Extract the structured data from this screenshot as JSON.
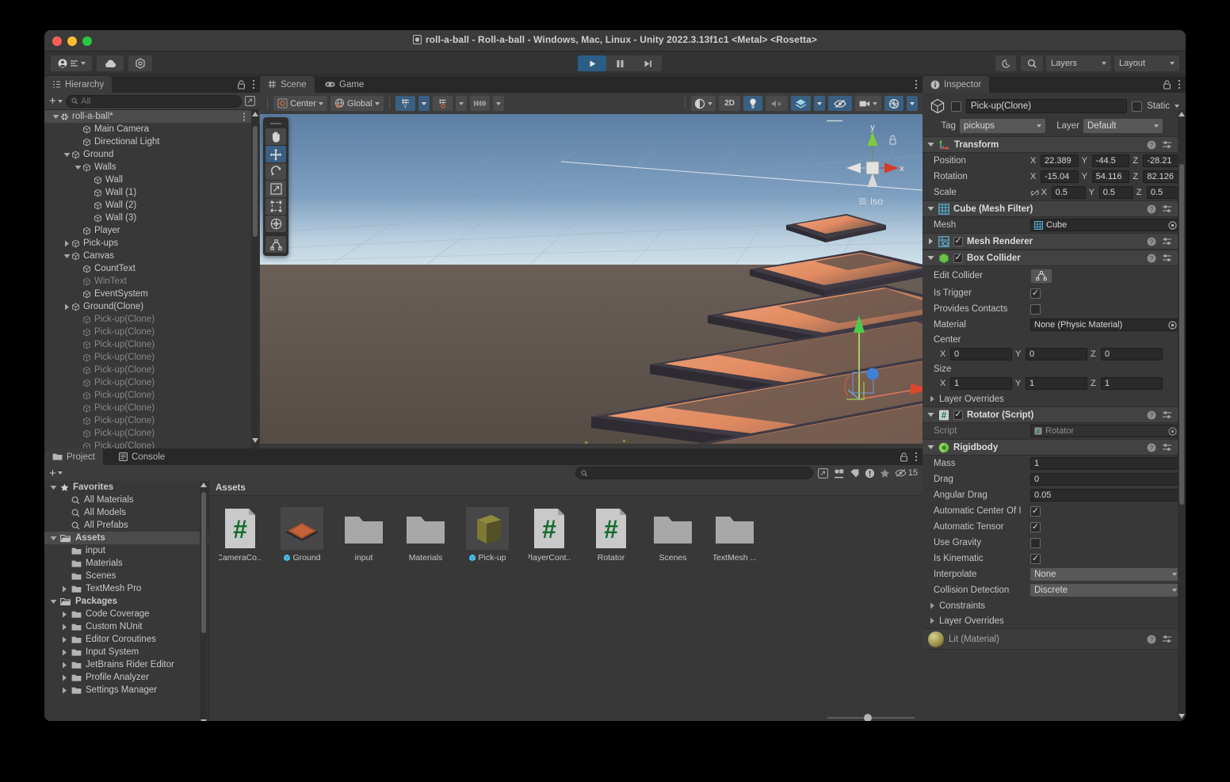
{
  "window": {
    "title": "roll-a-ball - Roll-a-ball - Windows, Mac, Linux - Unity 2022.3.13f1c1 <Metal> <Rosetta>",
    "title_icon": "unity-icon"
  },
  "toolbar": {
    "account_label": "account-icon",
    "cloud_label": "cloud-icon",
    "services_label": "services-icon",
    "play_label": "▶",
    "pause_label": "❚❚",
    "step_label": "▶❙",
    "undo_history_label": "undo-history-icon",
    "search_label": "search-icon",
    "layers_label": "Layers",
    "layout_label": "Layout"
  },
  "hierarchy": {
    "tab_label": "Hierarchy",
    "add_label": "+",
    "search_placeholder": "All",
    "items": [
      {
        "label": "roll-a-ball*",
        "depth": 0,
        "arrow": "down",
        "icon": "unity-scene-icon",
        "selected": true,
        "dim": false
      },
      {
        "label": "Main Camera",
        "depth": 2,
        "arrow": "none",
        "icon": "cube-icon",
        "selected": false,
        "dim": false
      },
      {
        "label": "Directional Light",
        "depth": 2,
        "arrow": "none",
        "icon": "cube-icon",
        "selected": false,
        "dim": false
      },
      {
        "label": "Ground",
        "depth": 1,
        "arrow": "down",
        "icon": "cube-icon",
        "selected": false,
        "dim": false
      },
      {
        "label": "Walls",
        "depth": 2,
        "arrow": "down",
        "icon": "cube-icon",
        "selected": false,
        "dim": false
      },
      {
        "label": "Wall",
        "depth": 3,
        "arrow": "none",
        "icon": "cube-icon",
        "selected": false,
        "dim": false
      },
      {
        "label": "Wall (1)",
        "depth": 3,
        "arrow": "none",
        "icon": "cube-icon",
        "selected": false,
        "dim": false
      },
      {
        "label": "Wall (2)",
        "depth": 3,
        "arrow": "none",
        "icon": "cube-icon",
        "selected": false,
        "dim": false
      },
      {
        "label": "Wall (3)",
        "depth": 3,
        "arrow": "none",
        "icon": "cube-icon",
        "selected": false,
        "dim": false
      },
      {
        "label": "Player",
        "depth": 2,
        "arrow": "none",
        "icon": "cube-icon",
        "selected": false,
        "dim": false
      },
      {
        "label": "Pick-ups",
        "depth": 1,
        "arrow": "right",
        "icon": "cube-icon",
        "selected": false,
        "dim": false
      },
      {
        "label": "Canvas",
        "depth": 1,
        "arrow": "down",
        "icon": "cube-icon",
        "selected": false,
        "dim": false
      },
      {
        "label": "CountText",
        "depth": 2,
        "arrow": "none",
        "icon": "cube-icon",
        "selected": false,
        "dim": false
      },
      {
        "label": "WinText",
        "depth": 2,
        "arrow": "none",
        "icon": "cube-icon",
        "selected": false,
        "dim": true
      },
      {
        "label": "EventSystem",
        "depth": 2,
        "arrow": "none",
        "icon": "cube-icon",
        "selected": false,
        "dim": false
      },
      {
        "label": "Ground(Clone)",
        "depth": 1,
        "arrow": "right",
        "icon": "cube-icon",
        "selected": false,
        "dim": false
      },
      {
        "label": "Pick-up(Clone)",
        "depth": 2,
        "arrow": "none",
        "icon": "cube-icon",
        "selected": false,
        "dim": true
      },
      {
        "label": "Pick-up(Clone)",
        "depth": 2,
        "arrow": "none",
        "icon": "cube-icon",
        "selected": false,
        "dim": true
      },
      {
        "label": "Pick-up(Clone)",
        "depth": 2,
        "arrow": "none",
        "icon": "cube-icon",
        "selected": false,
        "dim": true
      },
      {
        "label": "Pick-up(Clone)",
        "depth": 2,
        "arrow": "none",
        "icon": "cube-icon",
        "selected": false,
        "dim": true
      },
      {
        "label": "Pick-up(Clone)",
        "depth": 2,
        "arrow": "none",
        "icon": "cube-icon",
        "selected": false,
        "dim": true
      },
      {
        "label": "Pick-up(Clone)",
        "depth": 2,
        "arrow": "none",
        "icon": "cube-icon",
        "selected": false,
        "dim": true
      },
      {
        "label": "Pick-up(Clone)",
        "depth": 2,
        "arrow": "none",
        "icon": "cube-icon",
        "selected": false,
        "dim": true
      },
      {
        "label": "Pick-up(Clone)",
        "depth": 2,
        "arrow": "none",
        "icon": "cube-icon",
        "selected": false,
        "dim": true
      },
      {
        "label": "Pick-up(Clone)",
        "depth": 2,
        "arrow": "none",
        "icon": "cube-icon",
        "selected": false,
        "dim": true
      },
      {
        "label": "Pick-up(Clone)",
        "depth": 2,
        "arrow": "none",
        "icon": "cube-icon",
        "selected": false,
        "dim": true
      },
      {
        "label": "Pick-up(Clone)",
        "depth": 2,
        "arrow": "none",
        "icon": "cube-icon",
        "selected": false,
        "dim": true
      }
    ]
  },
  "scene": {
    "tab_scene": "Scene",
    "tab_game": "Game",
    "pivot_label": "Center",
    "space_label": "Global",
    "view_2d_label": "2D",
    "gizmo_axis_x": "x",
    "gizmo_axis_y": "y",
    "gizmo_mode": "Iso"
  },
  "project": {
    "tab_project": "Project",
    "tab_console": "Console",
    "add_label": "+",
    "search_placeholder": "",
    "hidden_count": "15",
    "assets_header": "Assets",
    "tree": [
      {
        "label": "Favorites",
        "depth": 0,
        "arrow": "down",
        "icon": "star-icon",
        "bold": true,
        "selected": false
      },
      {
        "label": "All Materials",
        "depth": 1,
        "arrow": "none",
        "icon": "search-icon",
        "bold": false,
        "selected": false
      },
      {
        "label": "All Models",
        "depth": 1,
        "arrow": "none",
        "icon": "search-icon",
        "bold": false,
        "selected": false
      },
      {
        "label": "All Prefabs",
        "depth": 1,
        "arrow": "none",
        "icon": "search-icon",
        "bold": false,
        "selected": false
      },
      {
        "label": "Assets",
        "depth": 0,
        "arrow": "down",
        "icon": "folder-open-icon",
        "bold": true,
        "selected": true
      },
      {
        "label": "input",
        "depth": 1,
        "arrow": "none",
        "icon": "folder-icon",
        "bold": false,
        "selected": false
      },
      {
        "label": "Materials",
        "depth": 1,
        "arrow": "none",
        "icon": "folder-icon",
        "bold": false,
        "selected": false
      },
      {
        "label": "Scenes",
        "depth": 1,
        "arrow": "none",
        "icon": "folder-icon",
        "bold": false,
        "selected": false
      },
      {
        "label": "TextMesh Pro",
        "depth": 1,
        "arrow": "right",
        "icon": "folder-icon",
        "bold": false,
        "selected": false
      },
      {
        "label": "Packages",
        "depth": 0,
        "arrow": "down",
        "icon": "folder-open-icon",
        "bold": true,
        "selected": false
      },
      {
        "label": "Code Coverage",
        "depth": 1,
        "arrow": "right",
        "icon": "folder-icon",
        "bold": false,
        "selected": false
      },
      {
        "label": "Custom NUnit",
        "depth": 1,
        "arrow": "right",
        "icon": "folder-icon",
        "bold": false,
        "selected": false
      },
      {
        "label": "Editor Coroutines",
        "depth": 1,
        "arrow": "right",
        "icon": "folder-icon",
        "bold": false,
        "selected": false
      },
      {
        "label": "Input System",
        "depth": 1,
        "arrow": "right",
        "icon": "folder-icon",
        "bold": false,
        "selected": false
      },
      {
        "label": "JetBrains Rider Editor",
        "depth": 1,
        "arrow": "right",
        "icon": "folder-icon",
        "bold": false,
        "selected": false
      },
      {
        "label": "Profile Analyzer",
        "depth": 1,
        "arrow": "right",
        "icon": "folder-icon",
        "bold": false,
        "selected": false
      },
      {
        "label": "Settings Manager",
        "depth": 1,
        "arrow": "right",
        "icon": "folder-icon",
        "bold": false,
        "selected": false
      }
    ],
    "assets": [
      {
        "label": "CameraCo...",
        "type": "script",
        "badge": ""
      },
      {
        "label": "Ground",
        "type": "prefab-ground",
        "badge": "prefab-icon"
      },
      {
        "label": "input",
        "type": "folder",
        "badge": ""
      },
      {
        "label": "Materials",
        "type": "folder",
        "badge": ""
      },
      {
        "label": "Pick-up",
        "type": "prefab-cube",
        "badge": "prefab-icon"
      },
      {
        "label": "PlayerCont...",
        "type": "script",
        "badge": ""
      },
      {
        "label": "Rotator",
        "type": "script",
        "badge": ""
      },
      {
        "label": "Scenes",
        "type": "folder",
        "badge": ""
      },
      {
        "label": "TextMesh ...",
        "type": "folder",
        "badge": ""
      }
    ]
  },
  "inspector": {
    "tab_label": "Inspector",
    "object_name": "Pick-up(Clone)",
    "static_label": "Static",
    "tag_label": "Tag",
    "tag_value": "pickups",
    "layer_label": "Layer",
    "layer_value": "Default",
    "components": {
      "transform": {
        "title": "Transform",
        "position_label": "Position",
        "rotation_label": "Rotation",
        "scale_label": "Scale",
        "position": {
          "x": "22.389",
          "y": "-44.5",
          "z": "-28.21"
        },
        "rotation": {
          "x": "-15.04",
          "y": "54.116",
          "z": "82.126"
        },
        "scale": {
          "x": "0.5",
          "y": "0.5",
          "z": "0.5"
        }
      },
      "mesh_filter": {
        "title": "Cube (Mesh Filter)",
        "mesh_label": "Mesh",
        "mesh_value": "Cube"
      },
      "mesh_renderer": {
        "title": "Mesh Renderer",
        "enabled": true
      },
      "box_collider": {
        "title": "Box Collider",
        "enabled": true,
        "edit_collider_label": "Edit Collider",
        "is_trigger_label": "Is Trigger",
        "is_trigger": true,
        "provides_contacts_label": "Provides Contacts",
        "provides_contacts": false,
        "material_label": "Material",
        "material_value": "None (Physic Material)",
        "center_label": "Center",
        "center": {
          "x": "0",
          "y": "0",
          "z": "0"
        },
        "size_label": "Size",
        "size": {
          "x": "1",
          "y": "1",
          "z": "1"
        },
        "layer_overrides_label": "Layer Overrides"
      },
      "rotator": {
        "title": "Rotator (Script)",
        "enabled": true,
        "script_label": "Script",
        "script_value": "Rotator"
      },
      "rigidbody": {
        "title": "Rigidbody",
        "mass_label": "Mass",
        "mass_value": "1",
        "drag_label": "Drag",
        "drag_value": "0",
        "angular_drag_label": "Angular Drag",
        "angular_drag_value": "0.05",
        "auto_com_label": "Automatic Center Of I",
        "auto_com": true,
        "auto_tensor_label": "Automatic Tensor",
        "auto_tensor": true,
        "use_gravity_label": "Use Gravity",
        "use_gravity": false,
        "is_kinematic_label": "Is Kinematic",
        "is_kinematic": true,
        "interpolate_label": "Interpolate",
        "interpolate_value": "None",
        "collision_detection_label": "Collision Detection",
        "collision_detection_value": "Discrete",
        "constraints_label": "Constraints",
        "layer_overrides_label": "Layer Overrides"
      },
      "material": {
        "title": "Lit  (Material)"
      }
    }
  },
  "colors": {
    "accent_blue": "#2c5d87",
    "panel_bg": "#383838",
    "header_bg": "#424242",
    "field_bg": "#2a2a2a",
    "text": "#c4c4c4",
    "script_green": "#1a7a38",
    "ground_orange": "#e8936a",
    "sky_blue": "#6b8fb5"
  }
}
